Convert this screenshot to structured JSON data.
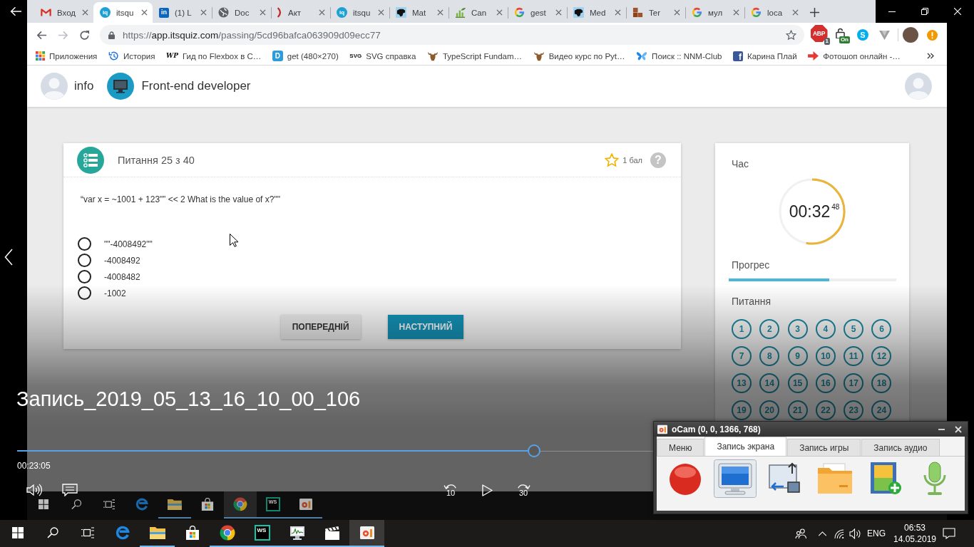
{
  "browser": {
    "tabs": [
      {
        "kind": "gmail",
        "title": "Вход",
        "selected": false
      },
      {
        "kind": "itsquiz",
        "logo_text": "iq",
        "title": "itsqu",
        "selected": true
      },
      {
        "kind": "linkedin",
        "logo_text": "in",
        "title": "(1) L",
        "selected": false
      },
      {
        "kind": "globe",
        "title": "Doc",
        "selected": false
      },
      {
        "kind": "bracket",
        "title": "Акт",
        "selected": false
      },
      {
        "kind": "itsquiz",
        "logo_text": "iq",
        "title": "itsqu",
        "selected": false
      },
      {
        "kind": "dog",
        "title": "Mat",
        "selected": false
      },
      {
        "kind": "chart",
        "title": "Can",
        "selected": false
      },
      {
        "kind": "google",
        "title": "gest",
        "selected": false
      },
      {
        "kind": "dog",
        "title": "Med",
        "selected": false
      },
      {
        "kind": "blocks",
        "title": "Ter",
        "selected": false
      },
      {
        "kind": "google",
        "title": "мул",
        "selected": false
      },
      {
        "kind": "google",
        "title": "loca",
        "selected": false
      }
    ],
    "url": {
      "scheme": "https://",
      "host": "app.itsquiz.com",
      "path": "/passing/5cd96bafca063909d09ecc77"
    },
    "extensions": [
      {
        "kind": "stop",
        "logo_text": "ABP",
        "badge": "1"
      },
      {
        "kind": "lock",
        "badge": "On"
      },
      {
        "kind": "disc",
        "logo_text": "S"
      },
      {
        "kind": "vee"
      }
    ],
    "bookmarks": [
      {
        "kind": "apps",
        "label": "Приложения"
      },
      {
        "kind": "history",
        "label": "История"
      },
      {
        "kind": "wp",
        "logo_text": "WP",
        "label": "Гид по Flexbox в С…"
      },
      {
        "kind": "square",
        "logo_text": "D",
        "label": "get (480×270)"
      },
      {
        "kind": "text",
        "logo_text": "SVG",
        "label": "SVG справка"
      },
      {
        "kind": "moose",
        "label": "TypeScript Fundam…"
      },
      {
        "kind": "moose",
        "label": "Видео курс по Pyt…"
      },
      {
        "kind": "butterfly",
        "label": "Поиск :: NNM-Club"
      },
      {
        "kind": "facebook",
        "logo_text": "f",
        "label": "Карина Плай"
      },
      {
        "kind": "arrow",
        "label": "Фотошоп онлайн -…"
      }
    ]
  },
  "page": {
    "header": {
      "user": "info",
      "course": "Front-end developer"
    },
    "question": {
      "counter": "Питання 25 з 40",
      "points": "1 бал",
      "help": "?",
      "text": "“var x = ~1001 + 123\"” << 2 What is the value of x?\"\"",
      "answers": [
        {
          "text": "\"\"-4008492\"\"",
          "selected": false
        },
        {
          "text": "-4008492",
          "selected": false
        },
        {
          "text": "-4008482",
          "selected": false
        },
        {
          "text": "-1002",
          "selected": false
        }
      ],
      "buttons": [
        {
          "kind": "secondary",
          "label": "ПОПЕРЕДНІЙ"
        },
        {
          "kind": "primary",
          "label": "НАСТУПНИЙ"
        }
      ]
    },
    "sidebar": {
      "time_label": "Час",
      "timer": {
        "value": "00:32",
        "fraction": "48",
        "level": 0.53
      },
      "progress_label": "Прогрес",
      "progress": {
        "level": 0.6
      },
      "questions_label": "Питання",
      "questions": [
        "1",
        "2",
        "3",
        "4",
        "5",
        "6",
        "7",
        "8",
        "9",
        "10",
        "11",
        "12",
        "13",
        "14",
        "15",
        "16",
        "17",
        "18",
        "19",
        "20",
        "21",
        "22",
        "23",
        "24"
      ]
    }
  },
  "recorded_taskbar": {
    "items": [
      {
        "kind": "start",
        "running": false,
        "active": false
      },
      {
        "kind": "search",
        "running": false,
        "active": false
      },
      {
        "kind": "taskview",
        "running": false,
        "active": false
      },
      {
        "kind": "edge",
        "running": false,
        "active": false
      },
      {
        "kind": "explorer",
        "running": true,
        "active": false
      },
      {
        "kind": "store",
        "running": false,
        "active": false
      },
      {
        "kind": "chrome",
        "running": true,
        "active": true
      },
      {
        "kind": "webstorm",
        "logo_text": "WS",
        "running": true,
        "active": false
      },
      {
        "kind": "ocam",
        "running": true,
        "active": false
      }
    ]
  },
  "player": {
    "title": "Запись_2019_05_13_16_10_00_106",
    "position": "00:23:05",
    "seek": {
      "level": 0.55
    },
    "paused": true,
    "rewind": "10",
    "forward": "30"
  },
  "ocam": {
    "title": "oCam (0, 0, 1366, 768)",
    "tabs": [
      {
        "label": "Меню",
        "selected": false
      },
      {
        "label": "Запись экрана",
        "selected": true
      },
      {
        "label": "Запись игры",
        "selected": false
      },
      {
        "label": "Запись аудио",
        "selected": false
      }
    ],
    "tools": [
      {
        "kind": "record",
        "selected": false
      },
      {
        "kind": "screen",
        "selected": true
      },
      {
        "kind": "resize",
        "selected": false
      },
      {
        "kind": "folder",
        "selected": false
      },
      {
        "kind": "codecs",
        "selected": false
      },
      {
        "kind": "mic",
        "selected": false
      }
    ]
  },
  "taskbar": {
    "items": [
      {
        "kind": "start",
        "running": false,
        "active": false
      },
      {
        "kind": "search",
        "running": false,
        "active": false
      },
      {
        "kind": "taskview",
        "running": false,
        "active": false
      },
      {
        "kind": "edge",
        "running": false,
        "active": false
      },
      {
        "kind": "explorer",
        "running": true,
        "active": false
      },
      {
        "kind": "store",
        "running": false,
        "active": false
      },
      {
        "kind": "chrome",
        "running": true,
        "active": false
      },
      {
        "kind": "webstorm",
        "logo_text": "WS",
        "running": true,
        "active": false
      },
      {
        "kind": "perfmon",
        "running": true,
        "active": false
      },
      {
        "kind": "movies",
        "running": true,
        "active": false
      },
      {
        "kind": "ocam",
        "running": true,
        "active": true
      }
    ],
    "language": "ENG",
    "time": "06:53",
    "date": "14.05.2019"
  }
}
